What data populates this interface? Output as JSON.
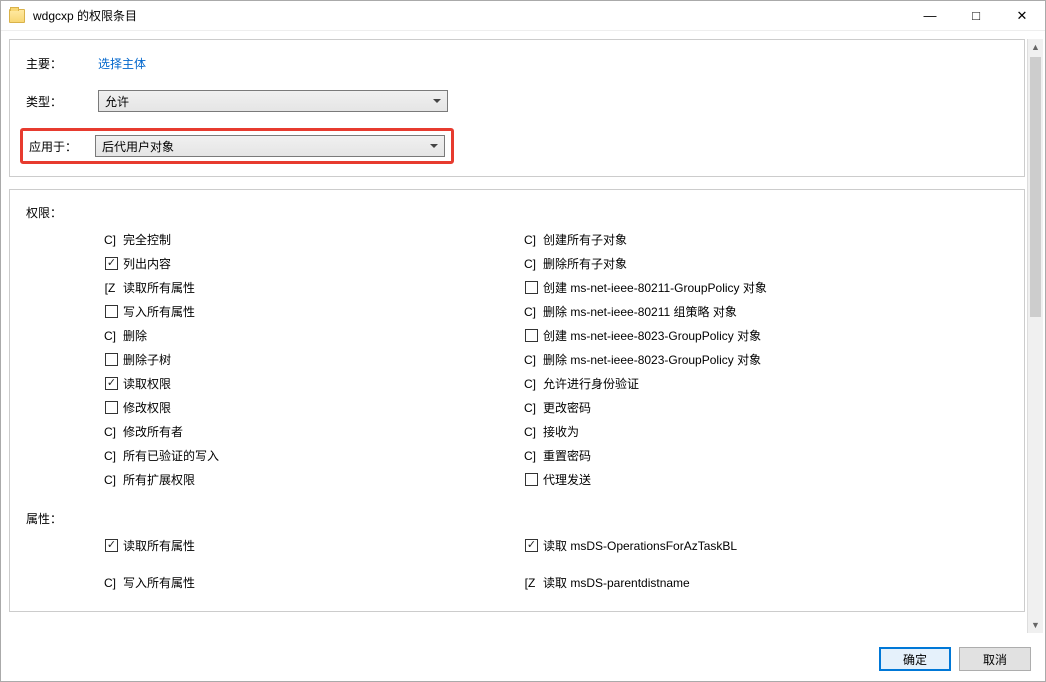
{
  "window": {
    "title": "wdgcxp 的权限条目"
  },
  "header": {
    "principal_label": "主要：",
    "principal_link": "选择主体",
    "type_label": "类型：",
    "type_value": "允许",
    "applies_label": "应用于：",
    "applies_value": "后代用户对象"
  },
  "permissions": {
    "section_label": "权限：",
    "left": [
      {
        "prefix": "C]",
        "label": "完全控制"
      },
      {
        "checkbox": true,
        "checked": true,
        "label": "列出内容"
      },
      {
        "prefix": "[Z",
        "label": "读取所有属性"
      },
      {
        "checkbox": true,
        "checked": false,
        "label": "写入所有属性"
      },
      {
        "prefix": "C]",
        "label": "删除"
      },
      {
        "checkbox": true,
        "checked": false,
        "label": "删除子树"
      },
      {
        "checkbox": true,
        "checked": true,
        "label": "读取权限"
      },
      {
        "checkbox": true,
        "checked": false,
        "label": "修改权限"
      },
      {
        "prefix": "C]",
        "label": "修改所有者"
      },
      {
        "prefix": "C]",
        "label": "所有已验证的写入"
      },
      {
        "prefix": "C]",
        "label": "所有扩展权限"
      }
    ],
    "right": [
      {
        "prefix": "C]",
        "label": "创建所有子对象"
      },
      {
        "prefix": "C]",
        "label": "删除所有子对象"
      },
      {
        "checkbox": true,
        "checked": false,
        "label": "创建 ms-net-ieee-80211-GroupPolicy 对象"
      },
      {
        "prefix": "C]",
        "label": "删除 ms-net-ieee-80211 组策略 对象"
      },
      {
        "checkbox": true,
        "checked": false,
        "label": "创建 ms-net-ieee-8023-GroupPolicy 对象"
      },
      {
        "prefix": "C]",
        "label": "删除 ms-net-ieee-8023-GroupPolicy 对象"
      },
      {
        "prefix": "C]",
        "label": "允许进行身份验证"
      },
      {
        "prefix": "C]",
        "label": "更改密码"
      },
      {
        "prefix": "C]",
        "label": "接收为"
      },
      {
        "prefix": "C]",
        "label": "重置密码"
      },
      {
        "checkbox": true,
        "checked": false,
        "label": "代理发送"
      }
    ]
  },
  "attributes": {
    "section_label": "属性：",
    "left": [
      {
        "checkbox": true,
        "checked": true,
        "label": "读取所有属性"
      },
      {
        "prefix": "C]",
        "label": "写入所有属性"
      }
    ],
    "right": [
      {
        "checkbox": true,
        "checked": true,
        "label": "读取 msDS-OperationsForAzTaskBL"
      },
      {
        "prefix": "[Z",
        "label": "读取 msDS-parentdistname"
      }
    ]
  },
  "buttons": {
    "ok": "确定",
    "cancel": "取消"
  }
}
